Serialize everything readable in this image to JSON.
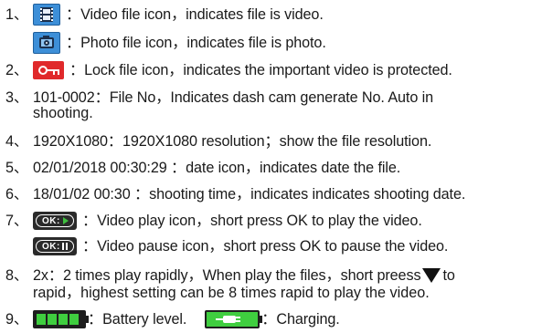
{
  "items": [
    {
      "num": "1、",
      "sep": "：",
      "text": "Video file icon，indicates file is video.",
      "icon": "video-file-icon"
    },
    {
      "sep": "：",
      "text": "Photo file icon，indicates file is photo.",
      "icon": "photo-file-icon"
    },
    {
      "num": "2、",
      "sep": "：",
      "text": "Lock file icon，indicates the important video is protected.",
      "icon": "lock-key-icon"
    },
    {
      "num": "3、",
      "text": "101-0002：File No，Indicates dash cam generate No. Auto in",
      "text_cont": "shooting."
    },
    {
      "num": "4、",
      "text": "1920X1080：1920X1080 resolution；show the file resolution."
    },
    {
      "num": "5、",
      "text": "02/01/2018 00:30:29 ：date icon，indicates date the file."
    },
    {
      "num": "6、",
      "text": "18/01/02 00:30 ：shooting time，indicates indicates shooting date."
    },
    {
      "num": "7、",
      "sep": "：",
      "text": "Video play icon，short press OK to play the video.",
      "icon": "ok-play-icon",
      "ok_label": "OK:"
    },
    {
      "sep": "：",
      "text": "Video pause icon，short press OK to pause the video.",
      "icon": "ok-pause-icon",
      "ok_label": "OK:"
    },
    {
      "num": "8、",
      "text_a": "2x：2 times play rapidly，When play the files，short preess",
      "text_b": "to",
      "text_cont": "rapid，highest setting can be 8 times rapid to play the video.",
      "icon": "down-triangle-icon"
    },
    {
      "num": "9、",
      "battery_sep": "：",
      "battery_text": "Battery level.",
      "charging_sep": "：",
      "charging_text": "Charging.",
      "icons": [
        "battery-icon",
        "charging-icon"
      ]
    }
  ],
  "colors": {
    "video_icon_blue": "#3d8fd8",
    "lock_icon_red": "#e0292b",
    "battery_green": "#3fce3f",
    "text": "#1a1a1a"
  }
}
